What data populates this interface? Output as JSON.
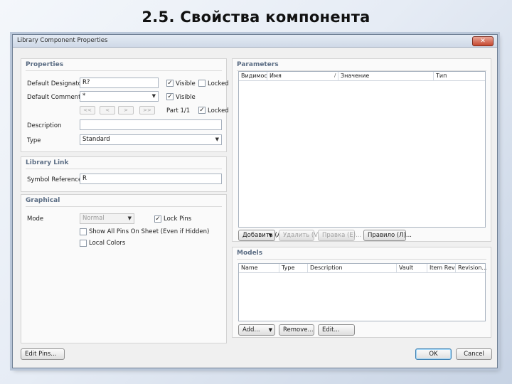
{
  "slide": {
    "title": "2.5. Свойства компонента"
  },
  "dialog": {
    "title": "Library Component Properties",
    "close_symbol": "✕"
  },
  "properties": {
    "heading": "Properties",
    "default_designator_label": "Default Designator",
    "default_designator_value": "R?",
    "default_comment_label": "Default Comment",
    "default_comment_value": "*",
    "visible_label": "Visible",
    "locked_label": "Locked",
    "nav_buttons": [
      "<<",
      "<",
      ">",
      ">>"
    ],
    "part_label": "Part 1/1",
    "description_label": "Description",
    "description_value": "",
    "type_label": "Type",
    "type_value": "Standard",
    "designator_visible_checked": true,
    "designator_locked_checked": false,
    "comment_visible_checked": true,
    "part_locked_checked": true
  },
  "library_link": {
    "heading": "Library Link",
    "symbol_reference_label": "Symbol Reference",
    "symbol_reference_value": "R"
  },
  "graphical": {
    "heading": "Graphical",
    "mode_label": "Mode",
    "mode_value": "Normal",
    "lock_pins_label": "Lock Pins",
    "lock_pins_checked": true,
    "show_all_pins_label": "Show All Pins On Sheet (Even if Hidden)",
    "show_all_pins_checked": false,
    "local_colors_label": "Local Colors",
    "local_colors_checked": false
  },
  "parameters": {
    "heading": "Parameters",
    "columns": [
      "Видимос",
      "Имя",
      "/",
      "Значение",
      "Тип"
    ],
    "buttons": {
      "add": "Добавить (A)...",
      "remove": "Удалить (V)...",
      "edit": "Правка (E)...",
      "rule": "Правило (Л)..."
    }
  },
  "models": {
    "heading": "Models",
    "columns": [
      "Name",
      "Type",
      "Description",
      "Vault",
      "Item Rev...",
      "Revision..."
    ],
    "buttons": {
      "add": "Add...",
      "remove": "Remove...",
      "edit": "Edit..."
    }
  },
  "footer": {
    "edit_pins": "Edit Pins...",
    "ok": "OK",
    "cancel": "Cancel"
  },
  "colors": {
    "heading": "#5b6d84",
    "panel": "#fafafa",
    "dialog": "#f0f0f0",
    "close": "#c6482f"
  }
}
